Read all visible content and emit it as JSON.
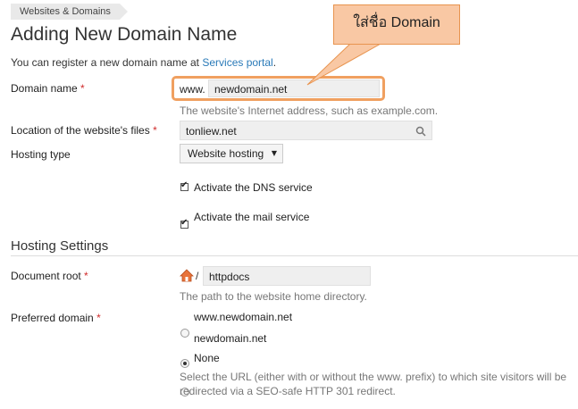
{
  "breadcrumb": "Websites & Domains",
  "page_title": "Adding New Domain Name",
  "intro": {
    "text": "You can register a new domain name at ",
    "link": "Services portal",
    "end": "."
  },
  "domain_name": {
    "label": "Domain name",
    "required": "*",
    "prefix": "www.",
    "value": "newdomain.net",
    "hint": "The website's Internet address, such as example.com."
  },
  "location": {
    "label": "Location of the website's files",
    "required": "*",
    "value": "tonliew.net"
  },
  "hosting_type": {
    "label": "Hosting type",
    "value": "Website hosting",
    "arrow": "▼"
  },
  "checkboxes": [
    {
      "label": "Activate the DNS service",
      "checked": true
    },
    {
      "label": "Activate the mail service",
      "checked": true
    }
  ],
  "hosting_settings": {
    "heading": "Hosting Settings"
  },
  "document_root": {
    "label": "Document root",
    "required": "*",
    "slash": "/",
    "value": "httpdocs",
    "hint": "The path to the website home directory."
  },
  "preferred_domain": {
    "label": "Preferred domain",
    "required": "*",
    "options": [
      {
        "label": "www.newdomain.net",
        "selected": false
      },
      {
        "label": "newdomain.net",
        "selected": true
      },
      {
        "label": "None",
        "selected": false
      }
    ],
    "hint_line1": "Select the URL (either with or without the www. prefix) to which site visitors will be",
    "hint_line2": "redirected via a SEO-safe HTTP 301 redirect."
  },
  "callout": "ใส่ชื่อ Domain",
  "colors": {
    "link": "#2a7ab8",
    "required": "#d02b2b",
    "callout_fill": "#f9c8a4",
    "callout_border": "#e8944f"
  }
}
